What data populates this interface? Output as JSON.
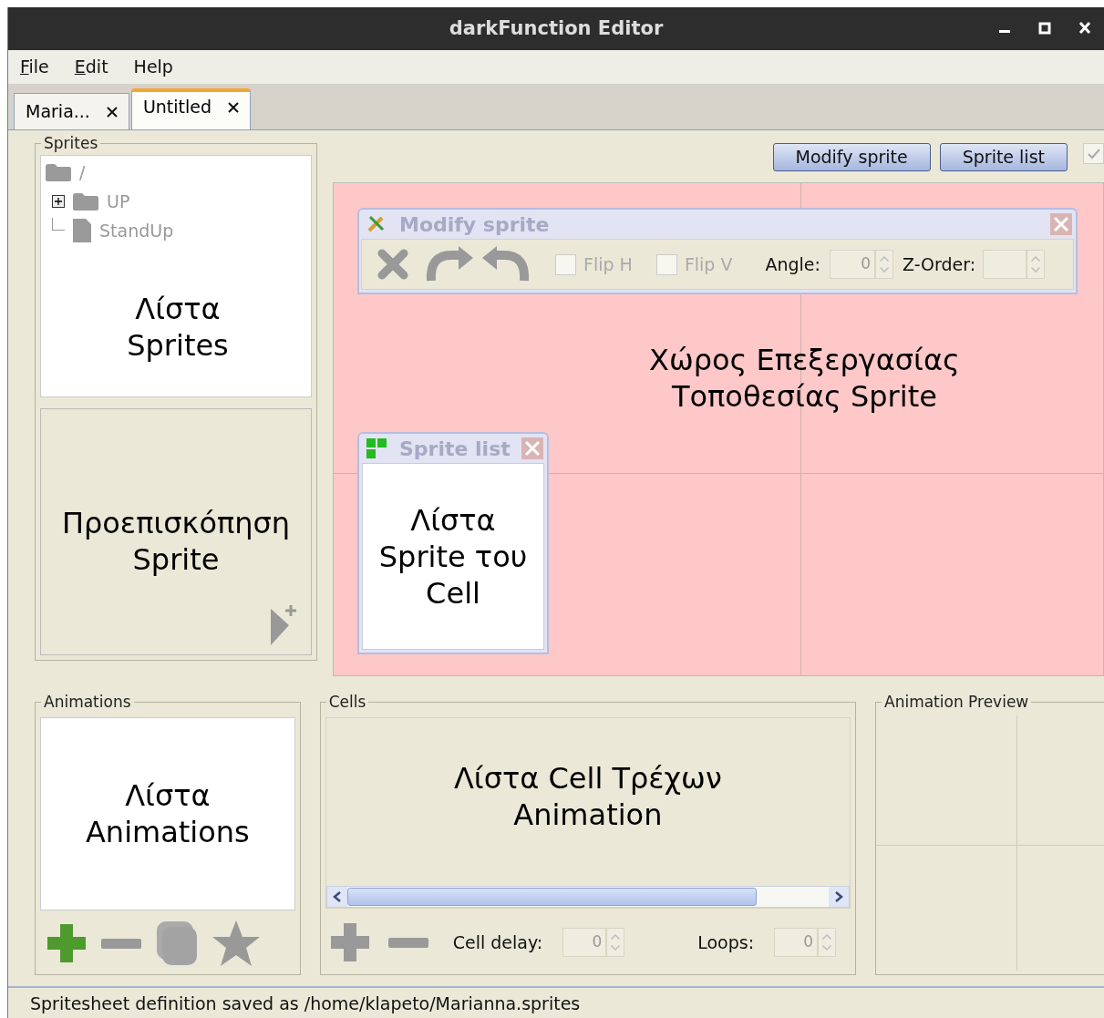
{
  "window": {
    "title": "darkFunction Editor"
  },
  "menu": [
    {
      "label": "File",
      "mnemonic": true
    },
    {
      "label": "Edit",
      "mnemonic": true
    },
    {
      "label": "Help",
      "mnemonic": false
    }
  ],
  "tabs": [
    {
      "label": "Maria...",
      "selected": false
    },
    {
      "label": "Untitled",
      "selected": true
    }
  ],
  "sprites": {
    "title": "Sprites",
    "tree": [
      {
        "label": "/",
        "kind": "folder",
        "children": [
          {
            "label": "UP",
            "kind": "folder",
            "expanded": false
          },
          {
            "label": "StandUp",
            "kind": "file"
          }
        ]
      }
    ],
    "list_label": "Λίστα\nSprites",
    "preview_label": "Προεπισκόπηση\nSprite"
  },
  "toolbar": {
    "buttons": [
      "Modify sprite",
      "Sprite list"
    ],
    "checkbox": {
      "checked": true
    }
  },
  "canvas": {
    "label": "Χώρος Επεξεργασίας\nΤοποθεσίας Sprite",
    "modify_window": {
      "title": "Modify sprite",
      "flips": [
        {
          "label": "Flip H",
          "checked": false
        },
        {
          "label": "Flip V",
          "checked": false
        }
      ],
      "angle": {
        "label": "Angle:",
        "value": "0"
      },
      "z_order": {
        "label": "Z-Order:"
      }
    },
    "sprite_list_window": {
      "title": "Sprite list",
      "label": "Λίστα\nSprite του\nCell"
    }
  },
  "animations": {
    "title": "Animations",
    "label": "Λίστα\nAnimations"
  },
  "cells": {
    "title": "Cells",
    "label": "Λίστα Cell Τρέχων\nAnimation",
    "cell_delay": {
      "label": "Cell delay:",
      "value": "0"
    },
    "loops": {
      "label": "Loops:",
      "value": "0"
    }
  },
  "preview": {
    "title": "Animation Preview"
  },
  "status_bar": "Spritesheet definition saved as /home/klapeto/Marianna.sprites"
}
